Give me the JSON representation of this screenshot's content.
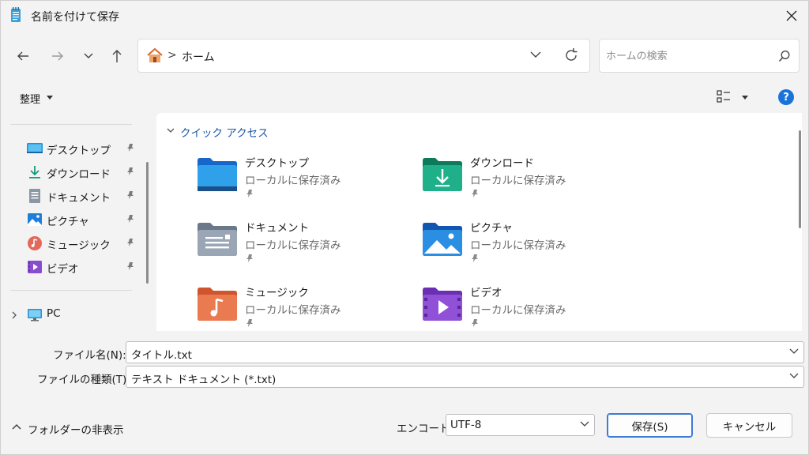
{
  "window": {
    "title": "名前を付けて保存",
    "title_icon": "notepad-icon"
  },
  "nav": {
    "back_icon": "arrow-left-icon",
    "forward_icon": "arrow-right-icon",
    "recent_icon": "chevron-down-icon",
    "up_icon": "arrow-up-icon"
  },
  "address": {
    "path": "ホーム",
    "separator": ">"
  },
  "search": {
    "placeholder": "ホームの検索"
  },
  "toolbar": {
    "organize_label": "整理",
    "help_label": "?"
  },
  "sidebar": {
    "items": [
      {
        "label": "デスクトップ",
        "icon": "desktop-icon"
      },
      {
        "label": "ダウンロード",
        "icon": "download-icon"
      },
      {
        "label": "ドキュメント",
        "icon": "document-icon"
      },
      {
        "label": "ピクチャ",
        "icon": "picture-icon"
      },
      {
        "label": "ミュージック",
        "icon": "music-icon"
      },
      {
        "label": "ビデオ",
        "icon": "video-icon"
      }
    ],
    "pc_label": "PC"
  },
  "quick_access": {
    "header": "クイック アクセス",
    "tiles": [
      {
        "name": "デスクトップ",
        "status": "ローカルに保存済み",
        "icon": "desktop-folder-icon"
      },
      {
        "name": "ダウンロード",
        "status": "ローカルに保存済み",
        "icon": "download-folder-icon"
      },
      {
        "name": "ドキュメント",
        "status": "ローカルに保存済み",
        "icon": "document-folder-icon"
      },
      {
        "name": "ピクチャ",
        "status": "ローカルに保存済み",
        "icon": "picture-folder-icon"
      },
      {
        "name": "ミュージック",
        "status": "ローカルに保存済み",
        "icon": "music-folder-icon"
      },
      {
        "name": "ビデオ",
        "status": "ローカルに保存済み",
        "icon": "video-folder-icon"
      }
    ]
  },
  "form": {
    "filename_label": "ファイル名(N):",
    "filename_value": "タイトル.txt",
    "filetype_label": "ファイルの種類(T):",
    "filetype_value": "テキスト ドキュメント (*.txt)",
    "encoding_label": "エンコード:",
    "encoding_value": "UTF-8"
  },
  "footer": {
    "hide_folders_label": "フォルダーの非表示",
    "save_label": "保存(S)",
    "cancel_label": "キャンセル"
  },
  "colors": {
    "accent": "#1a73d9",
    "link": "#1c5aa8"
  }
}
